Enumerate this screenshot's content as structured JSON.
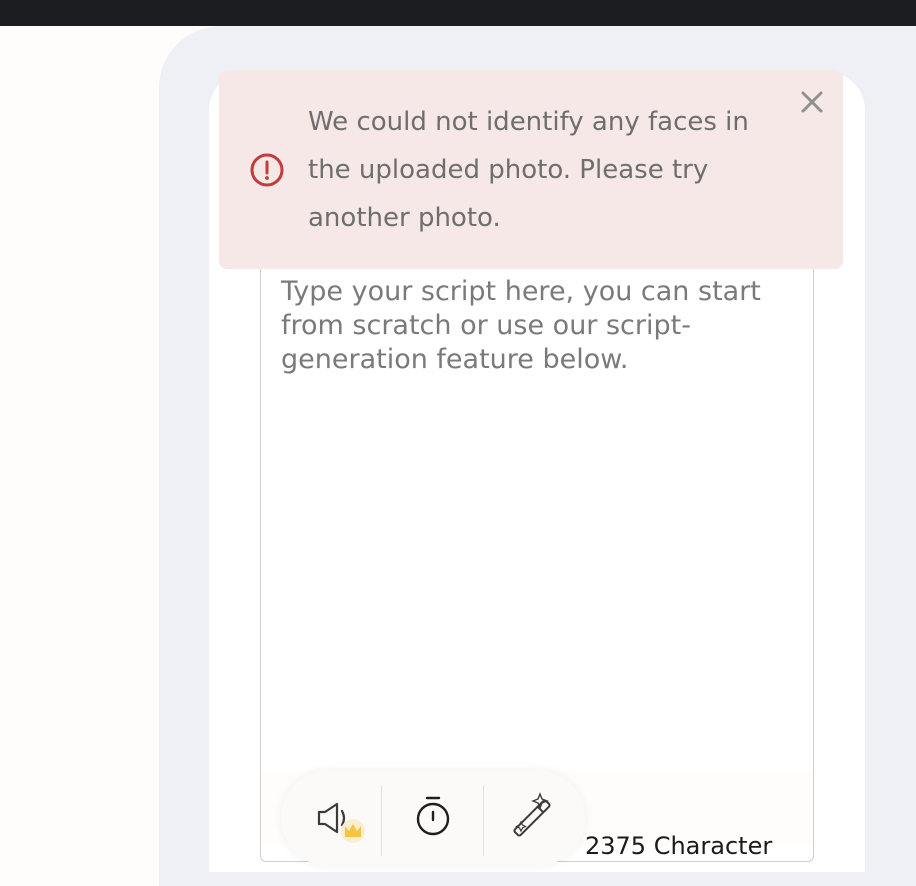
{
  "alert": {
    "message": "We could not identify any faces in the uploaded photo. Please try another photo.",
    "icon": "error-circle-icon",
    "close_icon": "close-icon",
    "color": "#c43b3b",
    "background": "#f7e8e8"
  },
  "script_editor": {
    "placeholder": "Type your script here, you can start from scratch or use our script-generation feature below.",
    "value": ""
  },
  "toolbar": {
    "tools": [
      {
        "icon": "speaker-voice-icon",
        "badge_icon": "crown-premium-icon",
        "badge_color": "#f4c542"
      },
      {
        "icon": "stopwatch-icon"
      },
      {
        "icon": "magic-wand-icon"
      }
    ]
  },
  "character_count": {
    "label": "2375 Character"
  },
  "colors": {
    "topbar": "#1c1d20",
    "panel": "#eff0f5",
    "card": "#ffffff"
  }
}
